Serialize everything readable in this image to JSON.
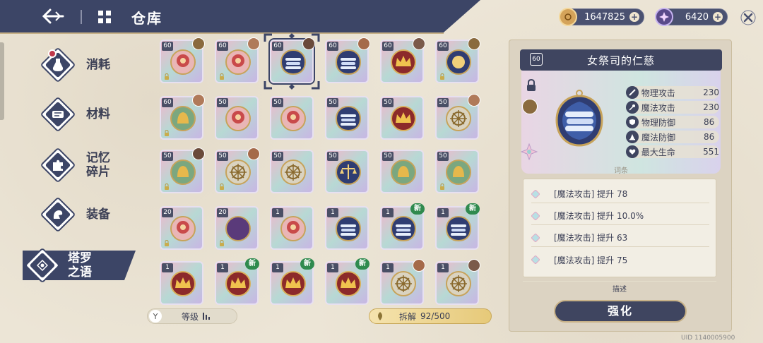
{
  "header": {
    "title": "仓库",
    "gold": "1647825",
    "gems": "6420"
  },
  "nav": [
    {
      "label": "消耗"
    },
    {
      "label": "材料"
    },
    {
      "label": "记忆\n碎片"
    },
    {
      "label": "装备"
    },
    {
      "label": "塔罗\n之语",
      "active": true
    }
  ],
  "cards": [
    {
      "level": "60",
      "art": "flower",
      "avatar": true,
      "lock": true
    },
    {
      "level": "60",
      "art": "flower",
      "avatar": true,
      "lock": true
    },
    {
      "level": "60",
      "art": "scroll",
      "avatar": true,
      "lock": false,
      "selected": true
    },
    {
      "level": "60",
      "art": "scroll",
      "avatar": true,
      "lock": false
    },
    {
      "level": "60",
      "art": "crown",
      "avatar": true,
      "lock": false
    },
    {
      "level": "60",
      "art": "sun",
      "avatar": true,
      "lock": true
    },
    {
      "level": "60",
      "art": "bell",
      "avatar": true,
      "lock": true
    },
    {
      "level": "50",
      "art": "flower",
      "avatar": false,
      "lock": false
    },
    {
      "level": "50",
      "art": "flower",
      "avatar": false,
      "lock": false
    },
    {
      "level": "50",
      "art": "scroll",
      "avatar": false,
      "lock": false
    },
    {
      "level": "50",
      "art": "crown",
      "avatar": false,
      "lock": false
    },
    {
      "level": "50",
      "art": "wheel",
      "avatar": true,
      "lock": false
    },
    {
      "level": "50",
      "art": "bell",
      "avatar": true,
      "lock": true
    },
    {
      "level": "50",
      "art": "wheel",
      "avatar": true,
      "lock": true
    },
    {
      "level": "50",
      "art": "wheel",
      "avatar": false,
      "lock": false
    },
    {
      "level": "50",
      "art": "scale",
      "avatar": false,
      "lock": false
    },
    {
      "level": "50",
      "art": "bell",
      "avatar": false,
      "lock": false
    },
    {
      "level": "50",
      "art": "bell",
      "avatar": false,
      "lock": true
    },
    {
      "level": "20",
      "art": "flower",
      "avatar": false,
      "lock": true
    },
    {
      "level": "20",
      "art": "moon",
      "avatar": false,
      "lock": true
    },
    {
      "level": "1",
      "art": "flower",
      "avatar": false,
      "lock": false
    },
    {
      "level": "1",
      "art": "scroll",
      "avatar": false,
      "lock": false
    },
    {
      "level": "1",
      "art": "scroll",
      "avatar": false,
      "lock": false,
      "new": true
    },
    {
      "level": "1",
      "art": "scroll",
      "avatar": false,
      "lock": false,
      "new": true
    },
    {
      "level": "1",
      "art": "crown",
      "avatar": false,
      "lock": false
    },
    {
      "level": "1",
      "art": "crown",
      "avatar": false,
      "lock": false,
      "new": true
    },
    {
      "level": "1",
      "art": "crown",
      "avatar": false,
      "lock": false,
      "new": true
    },
    {
      "level": "1",
      "art": "crown",
      "avatar": false,
      "lock": false,
      "new": true
    },
    {
      "level": "1",
      "art": "wheel",
      "avatar": true,
      "lock": false
    },
    {
      "level": "1",
      "art": "wheel",
      "avatar": true,
      "lock": false
    }
  ],
  "new_label": "新",
  "footer": {
    "level_label": "等级",
    "dismantle_label": "拆解",
    "dismantle_count": "92/500"
  },
  "detail": {
    "level": "60",
    "name": "女祭司的仁慈",
    "stats": [
      {
        "name": "物理攻击",
        "value": "230",
        "icon": "sword-icon"
      },
      {
        "name": "魔法攻击",
        "value": "230",
        "icon": "wand-icon"
      },
      {
        "name": "物理防御",
        "value": "86",
        "icon": "shield-icon"
      },
      {
        "name": "魔法防御",
        "value": "86",
        "icon": "hat-icon"
      },
      {
        "name": "最大生命",
        "value": "551",
        "icon": "heart-icon"
      }
    ],
    "entry_label": "词条",
    "affixes": [
      "[魔法攻击] 提升 78",
      "[魔法攻击] 提升 10.0%",
      "[魔法攻击] 提升 63",
      "[魔法攻击] 提升 75"
    ],
    "desc_label": "描述",
    "upgrade_label": "强化"
  },
  "uid": "UID 1140005900",
  "colors": {
    "navy": "#3c4566",
    "gold": "#c7b187",
    "new_green": "#2f8a4e",
    "parchment": "#ece5d6"
  }
}
